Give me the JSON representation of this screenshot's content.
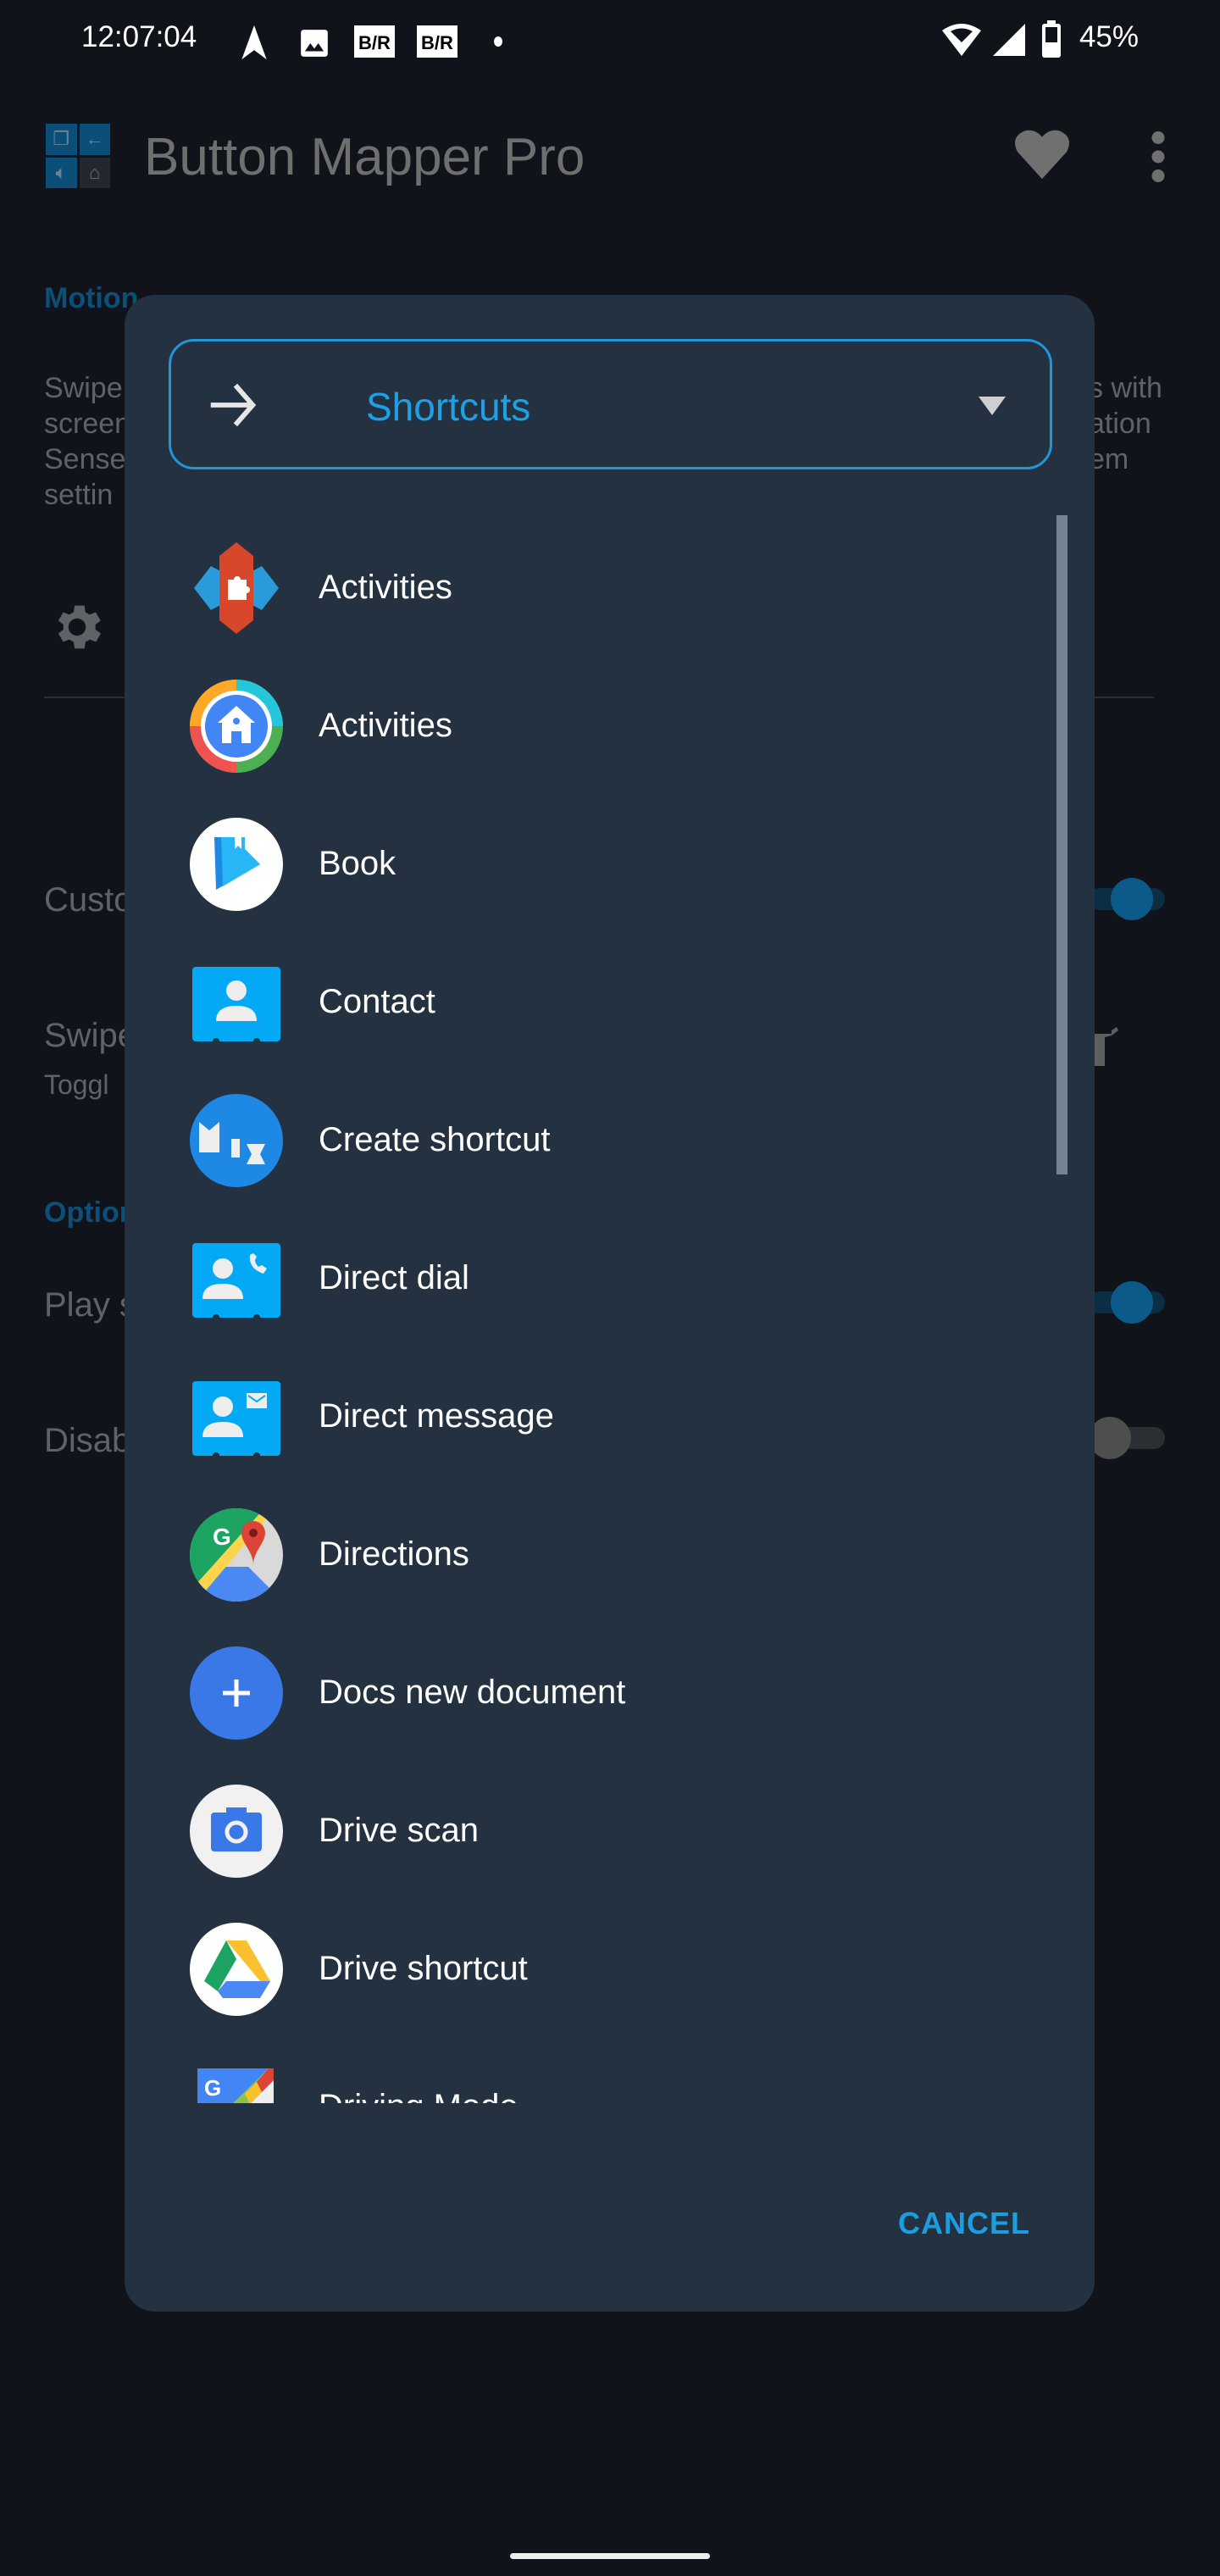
{
  "status_bar": {
    "time": "12:07:04",
    "battery_percent": "45%",
    "left_icons": [
      "navigation-arrow-icon",
      "gallery-icon",
      "br-app-icon",
      "br-app-icon",
      "dot-icon"
    ],
    "right_icons": [
      "wifi-icon",
      "cell-signal-icon",
      "battery-icon"
    ]
  },
  "background_app": {
    "title": "Button Mapper Pro",
    "section_motion": "Motion",
    "motion_desc_lines": [
      "Swipe",
      "screen",
      "Sense",
      "settin"
    ],
    "motion_desc_right_lines": [
      "s with",
      "ation",
      "em"
    ],
    "row_custom": "Custo",
    "row_swipe": "Swipe",
    "row_swipe_sub": "Toggl",
    "section_options": "Option",
    "row_play": "Play s",
    "row_disable": "Disab",
    "toggle_custom_on": true,
    "toggle_play_on": true,
    "toggle_disable_on": false
  },
  "dialog": {
    "selector_label": "Shortcuts",
    "items": [
      {
        "label": "Activities",
        "icon": "nova-launcher-icon"
      },
      {
        "label": "Activities",
        "icon": "action-launcher-icon"
      },
      {
        "label": "Book",
        "icon": "play-books-icon"
      },
      {
        "label": "Contact",
        "icon": "contact-card-icon"
      },
      {
        "label": "Create shortcut",
        "icon": "create-shortcut-icon"
      },
      {
        "label": "Direct dial",
        "icon": "direct-dial-icon"
      },
      {
        "label": "Direct message",
        "icon": "direct-message-icon"
      },
      {
        "label": "Directions",
        "icon": "google-maps-icon"
      },
      {
        "label": "Docs new document",
        "icon": "docs-new-icon"
      },
      {
        "label": "Drive scan",
        "icon": "drive-scan-icon"
      },
      {
        "label": "Drive shortcut",
        "icon": "google-drive-icon"
      },
      {
        "label": "Driving Mode",
        "icon": "driving-mode-icon"
      }
    ],
    "cancel_label": "CANCEL"
  },
  "colors": {
    "accent": "#1ea0e4",
    "dialog_bg": "#233140",
    "screen_bg": "#10141a"
  }
}
